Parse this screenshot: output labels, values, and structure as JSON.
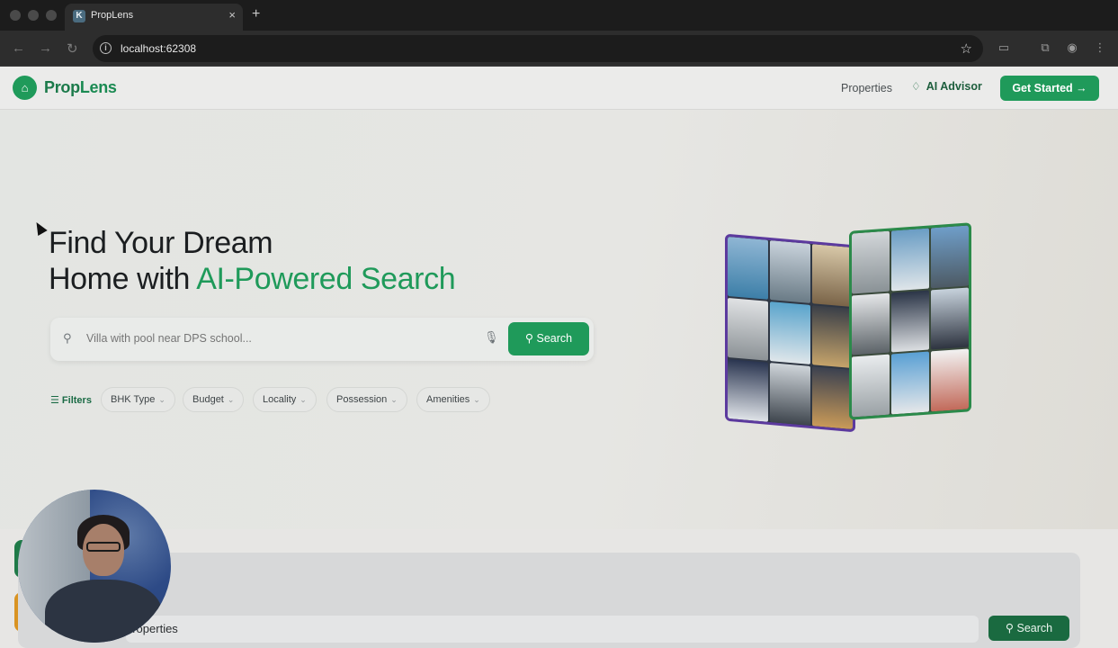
{
  "browser": {
    "tab_title": "PropLens",
    "favicon_glyph": "K",
    "new_tab": "+",
    "tab_close": "×",
    "url": "localhost:62308",
    "icons": [
      "back-icon",
      "forward-icon",
      "reload-icon",
      "site-info-icon",
      "star-icon",
      "reading-list-icon",
      "extensions-icon",
      "profile-icon",
      "menu-icon"
    ]
  },
  "navbar": {
    "brand_prop": "Prop",
    "brand_lens": "Lens",
    "links": {
      "properties": "Properties",
      "ai_advisor": "AI Advisor"
    },
    "cta": "Get Started →"
  },
  "hero": {
    "headline_line1": "Find Your Dream",
    "headline_line2_prefix": "Home with ",
    "headline_line2_accent": "AI-Powered Search",
    "search_placeholder": "Villa with pool near DPS school...",
    "search_button": "Search",
    "filters_label": "Filters",
    "chips": [
      "BHK Type",
      "Budget",
      "Locality",
      "Possession",
      "Amenities"
    ]
  },
  "lower": {
    "search_text": "properties",
    "search_button": "Search"
  },
  "colors": {
    "brand_green": "#1f9a5a",
    "dark_green": "#1a6a40",
    "cube_left_border": "#5c3a9e",
    "cube_right_border": "#2b8a4a",
    "accent_orange": "#d99322"
  }
}
